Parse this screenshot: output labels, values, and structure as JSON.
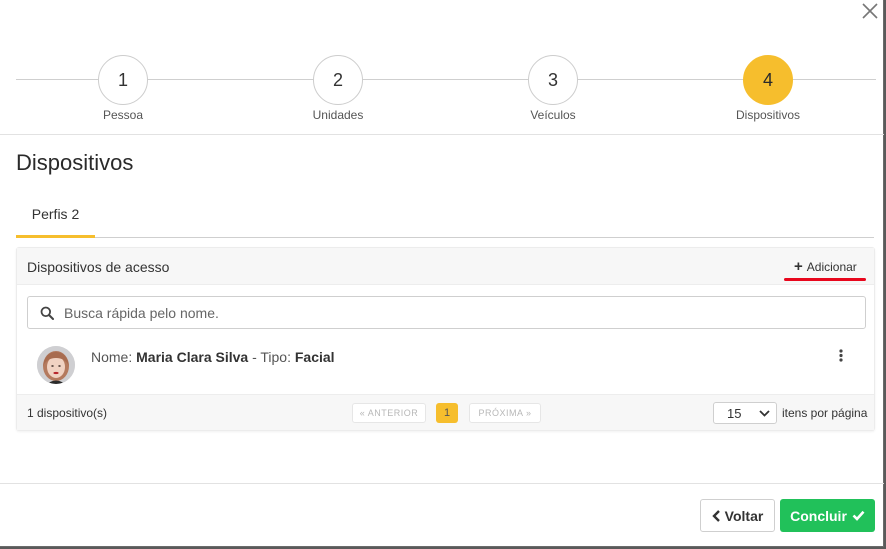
{
  "stepper": {
    "steps": [
      {
        "number": "1",
        "label": "Pessoa",
        "active": false
      },
      {
        "number": "2",
        "label": "Unidades",
        "active": false
      },
      {
        "number": "3",
        "label": "Veículos",
        "active": false
      },
      {
        "number": "4",
        "label": "Dispositivos",
        "active": true
      }
    ]
  },
  "page": {
    "title": "Dispositivos"
  },
  "tabs": [
    {
      "label": "Perfis 2",
      "active": true
    }
  ],
  "card": {
    "title": "Dispositivos de acesso",
    "add_label": "Adicionar",
    "search": {
      "placeholder": "Busca rápida pelo nome.",
      "value": ""
    },
    "devices": [
      {
        "name_prefix": "Nome: ",
        "name": "Maria Clara Silva",
        "type_prefix": " - Tipo: ",
        "type": "Facial"
      }
    ],
    "footer": {
      "count": "1 dispositivo(s)",
      "prev_label": "« ANTERIOR",
      "current_page": "1",
      "next_label": "PRÓXIMA »",
      "per_page_value": "15",
      "per_page_label": "itens por página"
    }
  },
  "actions": {
    "back_label": "Voltar",
    "done_label": "Concluir"
  },
  "colors": {
    "accent": "#f6be2d",
    "success": "#21c15a",
    "highlight": "#e8071d"
  },
  "icons": [
    "close-icon",
    "search-icon",
    "kebab-menu-icon",
    "plus-icon",
    "chevron-left-icon",
    "check-icon",
    "chevron-down-icon"
  ]
}
